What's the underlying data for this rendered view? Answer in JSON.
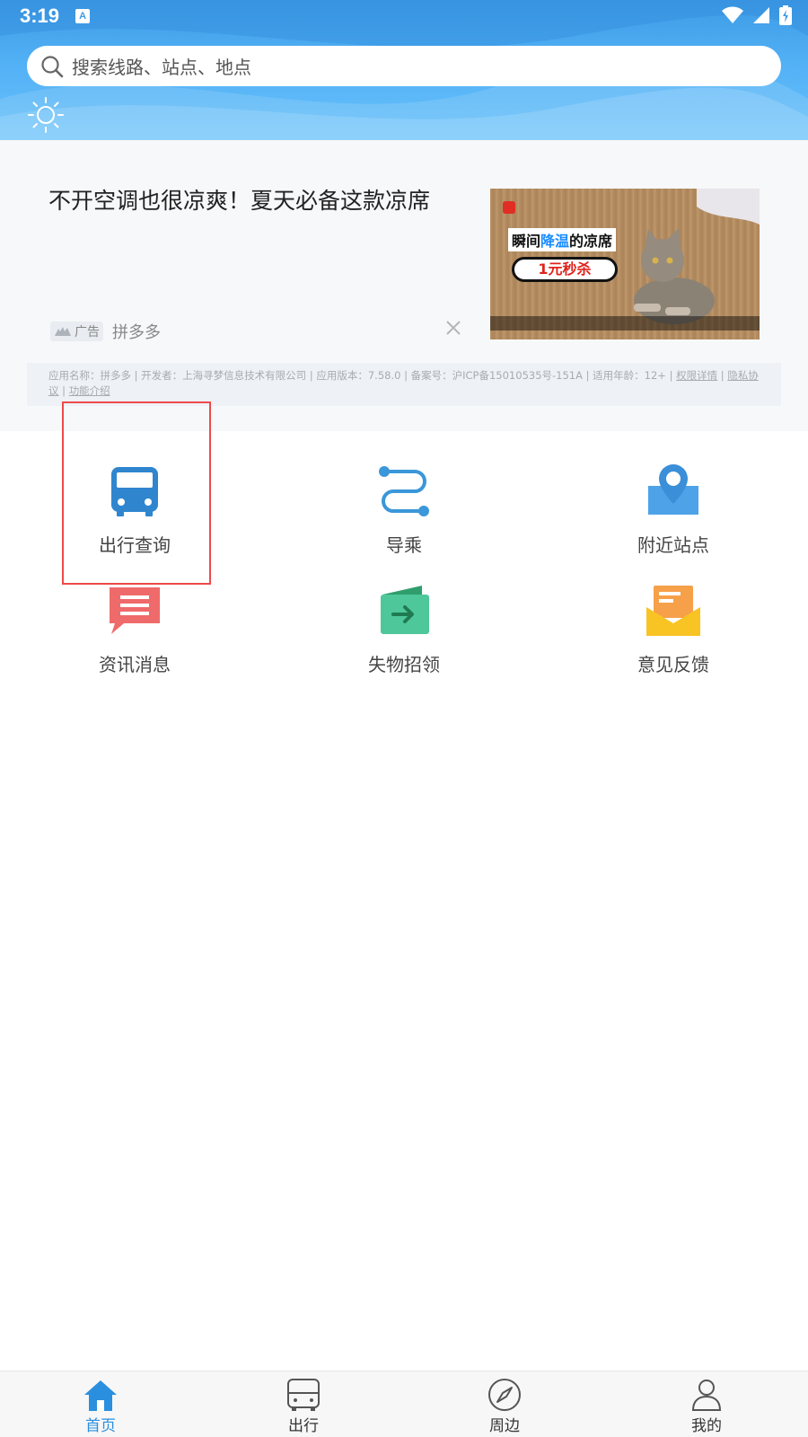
{
  "status_bar": {
    "time": "3:19",
    "notif_letter": "A"
  },
  "search": {
    "placeholder": "搜索线路、站点、地点"
  },
  "ad": {
    "title": "不开空调也很凉爽！夏天必备这款凉席",
    "tag": "广告",
    "source": "拼多多",
    "image_text_1a": "瞬间",
    "image_text_1b": "降温",
    "image_text_1c": "的凉席",
    "image_text_2": "1元秒杀",
    "info_text": "应用名称：拼多多 | 开发者：上海寻梦信息技术有限公司 | 应用版本：7.58.0 | 备案号：沪ICP备15010535号-151A | 适用年龄：12+ | ",
    "link_permissions": "权限详情",
    "link_privacy": "隐私协议",
    "link_features": "功能介绍"
  },
  "grid": [
    {
      "label": "出行查询",
      "icon": "bus-icon"
    },
    {
      "label": "导乘",
      "icon": "route-icon"
    },
    {
      "label": "附近站点",
      "icon": "map-pin-icon"
    },
    {
      "label": "资讯消息",
      "icon": "message-icon"
    },
    {
      "label": "失物招领",
      "icon": "wallet-icon"
    },
    {
      "label": "意见反馈",
      "icon": "mail-icon"
    }
  ],
  "bottom_nav": [
    {
      "label": "首页",
      "icon": "home-icon",
      "active": true
    },
    {
      "label": "出行",
      "icon": "bus-outline-icon",
      "active": false
    },
    {
      "label": "周边",
      "icon": "compass-icon",
      "active": false
    },
    {
      "label": "我的",
      "icon": "user-icon",
      "active": false
    }
  ],
  "colors": {
    "header_blue": "#4aa6ee",
    "active_nav": "#2a8fde",
    "highlight": "#ee4a4a",
    "bus": "#2f86cf",
    "route": "#3a97d9",
    "pin": "#4ea3e8",
    "message": "#ef6a6a",
    "wallet": "#4ec79a",
    "mail": "#f8c424"
  }
}
